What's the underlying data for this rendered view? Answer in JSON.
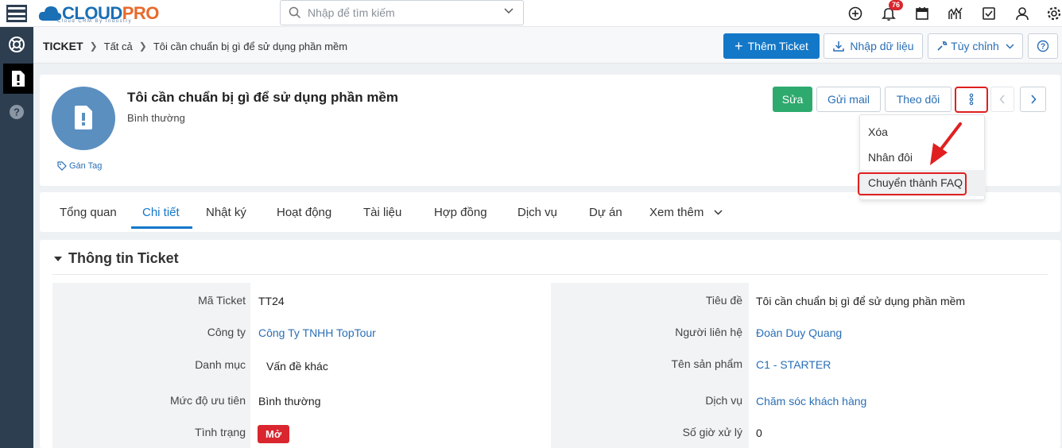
{
  "topbar": {
    "logo_main": "CLOUD",
    "logo_accent": "PRO",
    "logo_sub": "Cloud CRM By Industry",
    "search_placeholder": "Nhập để tìm kiếm",
    "notification_count": "76"
  },
  "breadcrumb": {
    "root": "TICKET",
    "level1": "Tất cả",
    "current": "Tôi cần chuẩn bị gì để sử dụng phần mềm"
  },
  "header_buttons": {
    "add": "Thêm Ticket",
    "import": "Nhập dữ liệu",
    "customize": "Tùy chỉnh"
  },
  "record": {
    "title": "Tôi cần chuẩn bị gì để sử dụng phần mềm",
    "priority": "Bình thường",
    "tag_label": "Gán Tag",
    "edit": "Sửa",
    "send_mail": "Gửi mail",
    "follow": "Theo dõi"
  },
  "more_menu": {
    "items": [
      "Xóa",
      "Nhân đôi",
      "Chuyển thành FAQ"
    ]
  },
  "tabs": [
    "Tổng quan",
    "Chi tiết",
    "Nhật ký",
    "Hoạt động",
    "Tài liệu",
    "Hợp đồng",
    "Dịch vụ",
    "Dự án",
    "Xem thêm"
  ],
  "section": {
    "title": "Thông tin Ticket"
  },
  "fields": {
    "left": [
      {
        "label": "Mã Ticket",
        "value": "TT24"
      },
      {
        "label": "Công ty",
        "value": "Công Ty TNHH TopTour"
      },
      {
        "label": "Danh mục",
        "value": "Vấn đề khác"
      },
      {
        "label": "Mức độ ưu tiên",
        "value": "Bình thường"
      },
      {
        "label": "Tình trạng",
        "value": "Mở"
      }
    ],
    "right": [
      {
        "label": "Tiêu đề",
        "value": "Tôi cần chuẩn bị gì để sử dụng phần mềm"
      },
      {
        "label": "Người liên hệ",
        "value": "Đoàn Duy Quang"
      },
      {
        "label": "Tên sản phẩm",
        "value": "C1 - STARTER"
      },
      {
        "label": "Dịch vụ",
        "value": "Chăm sóc khách hàng"
      },
      {
        "label": "Số giờ xử lý",
        "value": "0"
      }
    ]
  },
  "colors": {
    "primary": "#1478c8",
    "success": "#2eaa6e",
    "sidebar": "#2d3e50",
    "danger": "#d9262f",
    "link": "#2a6fb6"
  }
}
